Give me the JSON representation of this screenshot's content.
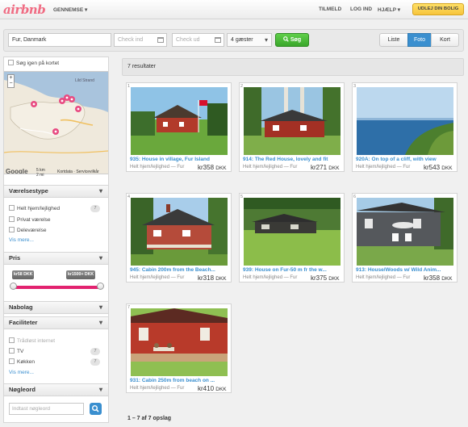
{
  "header": {
    "logo": "airbnb",
    "browse": "GENNEMSE ▾",
    "signup": "TILMELD",
    "login": "LOG IND",
    "help": "HJÆLP ▾",
    "host_button": "UDLEJ DIN BOLIG"
  },
  "search": {
    "location": "Fur, Danmark",
    "checkin_placeholder": "Check ind",
    "checkout_placeholder": "Check ud",
    "guests": "4 gæster",
    "button": "Søg"
  },
  "view_toggle": {
    "list": "Liste",
    "photo": "Foto",
    "map": "Kort",
    "active": "photo"
  },
  "sidebar": {
    "map_search_label": "Søg igen på kortet",
    "map_scale_km": "5 km",
    "map_scale_mi": "2 mi",
    "map_links": "Kortdata · Servicevilkår",
    "map_logo": "Google",
    "map_place": "Lild Strand",
    "room_type": {
      "title": "Værelsestype",
      "options": [
        {
          "label": "Helt hjem/lejlighed",
          "count": "7"
        },
        {
          "label": "Privat værelse"
        },
        {
          "label": "Deleværelse"
        }
      ],
      "more": "Vis mere..."
    },
    "price": {
      "title": "Pris",
      "min": "kr58 DKK",
      "max": "kr1500+ DKK",
      "range": [
        0,
        1
      ]
    },
    "neighborhood": {
      "title": "Nabolag"
    },
    "amenities": {
      "title": "Faciliteter",
      "options": [
        {
          "label": "Trådløst internet",
          "disabled": true
        },
        {
          "label": "TV",
          "count": "7"
        },
        {
          "label": "Køkken",
          "count": "7"
        }
      ],
      "more": "Vis mere..."
    },
    "keywords": {
      "title": "Nøgleord",
      "placeholder": "Indtast nøgleord"
    }
  },
  "results": {
    "summary": "7 resultater",
    "pager": "1 – 7 af 7 opslag",
    "listings": [
      {
        "num": "1",
        "title": "935: House in village, Fur Island",
        "type": "Helt hjem/lejlighed — Fur",
        "price": "kr358",
        "currency": "DKK"
      },
      {
        "num": "2",
        "title": "914: The Red House, lovely and fit",
        "type": "Helt hjem/lejlighed — Fur",
        "price": "kr271",
        "currency": "DKK"
      },
      {
        "num": "3",
        "title": "920A: On top of a cliff, with view",
        "type": "Helt hjem/lejlighed — Fur",
        "price": "kr543",
        "currency": "DKK"
      },
      {
        "num": "4",
        "title": "945: Cabin 200m from the Beach...",
        "type": "Helt hjem/lejlighed — Fur",
        "price": "kr318",
        "currency": "DKK"
      },
      {
        "num": "5",
        "title": "939: House on Fur-50 m fr the w...",
        "type": "Helt hjem/lejlighed — Fur",
        "price": "kr375",
        "currency": "DKK"
      },
      {
        "num": "6",
        "title": "913: House/Woods w/ Wild Anim...",
        "type": "Helt hjem/lejlighed — Fur",
        "price": "kr358",
        "currency": "DKK"
      },
      {
        "num": "7",
        "title": "931: Cabin 250m from beach on ...",
        "type": "Helt hjem/lejlighed — Fur",
        "price": "kr410",
        "currency": "DKK"
      }
    ]
  },
  "colors": {
    "brand": "#f06b82",
    "link": "#3a8fcf",
    "search_button": "#3aa72b",
    "host_button": "#f7c43c",
    "price_slider": "#e2226f"
  }
}
